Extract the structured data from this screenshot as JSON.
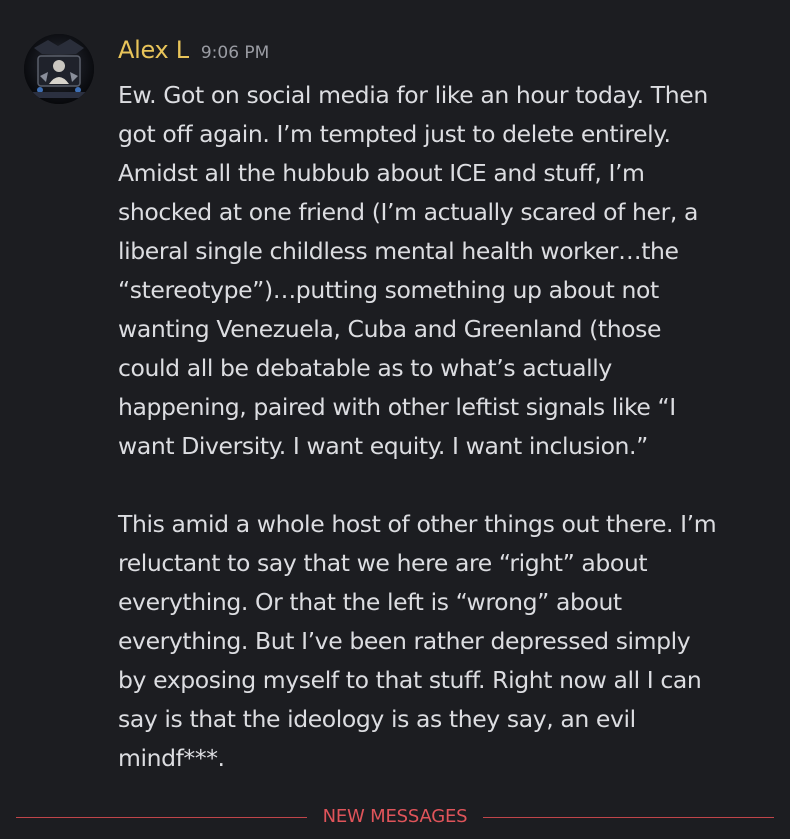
{
  "message": {
    "author": "Alex L",
    "timestamp": "9:06 PM",
    "paragraphs": [
      {
        "lines": [
          "Ew. Got on social media for like an hour today. Then",
          "got off again. I’m tempted just to delete entirely.",
          "Amidst all the hubbub about ICE and stuff, I’m",
          "shocked at one friend (I’m actually scared of her, a",
          "liberal single childless mental health worker…the",
          "“stereotype”)…putting something up about not",
          "wanting Venezuela, Cuba and Greenland (those",
          "could all be debatable as to what’s actually",
          "happening, paired with other leftist signals like “I",
          "want Diversity. I want equity. I want inclusion.”"
        ]
      },
      {
        "lines": [
          "This amid a whole host of other things out there. I’m",
          "reluctant to say that we here are “right” about",
          "everything. Or that the left is “wrong” about",
          "everything. But I’ve been rather depressed simply",
          "by exposing myself to that stuff. Right now all I can",
          "say is that the ideology is as they say, an evil",
          "mindf***."
        ]
      }
    ]
  },
  "divider": {
    "label": "NEW MESSAGES"
  },
  "colors": {
    "background": "#1c1d21",
    "author": "#e8c45a",
    "timestamp": "#9a9ca3",
    "text": "#dcdde1",
    "new_messages": "#e0545a"
  },
  "icons": {
    "avatar": "user-avatar-photo"
  }
}
